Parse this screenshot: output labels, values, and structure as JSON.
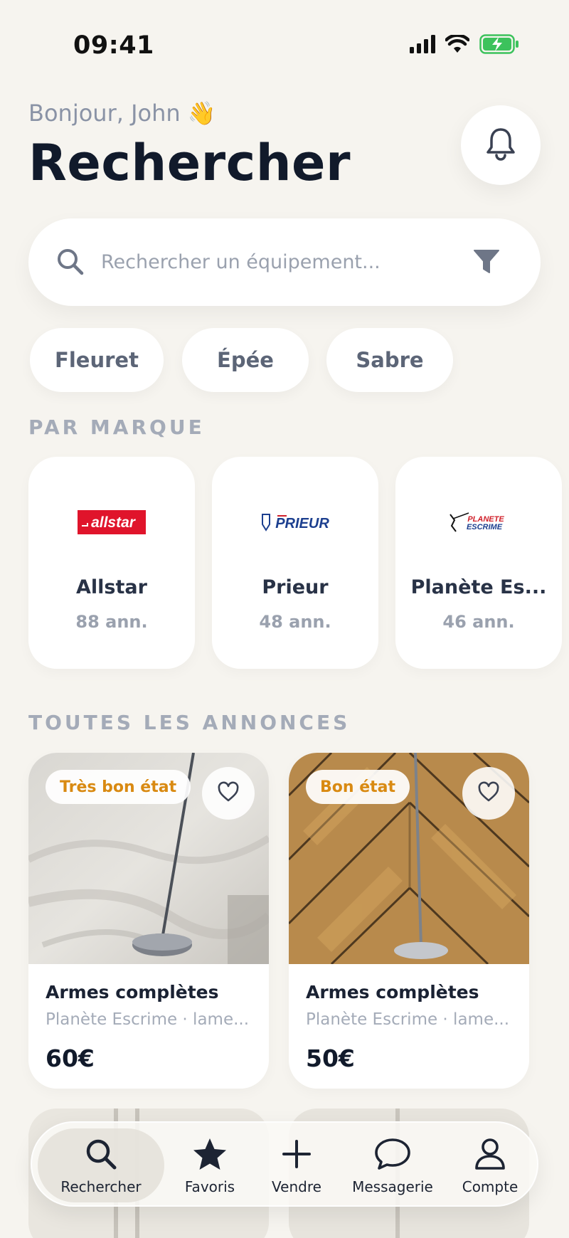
{
  "status_bar": {
    "time": "09:41"
  },
  "header": {
    "greeting": "Bonjour, John 👋",
    "title": "Rechercher"
  },
  "search": {
    "placeholder": "Rechercher un équipement..."
  },
  "weapon_filters": [
    {
      "label": "Fleuret"
    },
    {
      "label": "Épée"
    },
    {
      "label": "Sabre"
    }
  ],
  "brands_section": {
    "heading": "PAR MARQUE",
    "brands": [
      {
        "name": "Allstar",
        "count": "88 ann.",
        "logo_text": "allstar"
      },
      {
        "name": "Prieur",
        "count": "48 ann.",
        "logo_text": "PRIEUR"
      },
      {
        "name": "Planète Es...",
        "count": "46 ann.",
        "logo_text": "PLANETE ESCRIME"
      }
    ]
  },
  "listings_section": {
    "heading": "TOUTES LES ANNONCES",
    "listings": [
      {
        "condition": "Très bon état",
        "title": "Armes complètes",
        "meta": "Planète Escrime · lame...",
        "price": "60€"
      },
      {
        "condition": "Bon état",
        "title": "Armes complètes",
        "meta": "Planète Escrime · lame...",
        "price": "50€"
      }
    ]
  },
  "tab_bar": {
    "tabs": [
      {
        "label": "Rechercher",
        "icon": "search-icon",
        "active": true
      },
      {
        "label": "Favoris",
        "icon": "star-icon",
        "active": false
      },
      {
        "label": "Vendre",
        "icon": "plus-icon",
        "active": false
      },
      {
        "label": "Messagerie",
        "icon": "chat-bubble-icon",
        "active": false
      },
      {
        "label": "Compte",
        "icon": "person-icon",
        "active": false
      }
    ]
  },
  "colors": {
    "background": "#f6f4ef",
    "accent_condition": "#d98a12",
    "title": "#111a2b",
    "muted": "#9aa1ae"
  }
}
